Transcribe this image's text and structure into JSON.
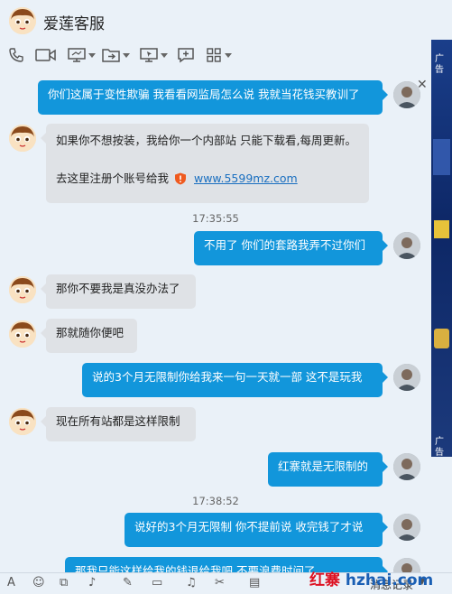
{
  "header": {
    "title": "爱莲客服"
  },
  "toolbar": {
    "icons": [
      "phone-icon",
      "video-icon",
      "screen-share-icon",
      "file-transfer-icon",
      "remote-desktop-icon",
      "add-icon",
      "apps-icon"
    ]
  },
  "messages": {
    "m1": "你们这属于变性欺骗 我看看网监局怎么说 我就当花钱买教训了",
    "m2_line1": "如果你不想按装，我给你一个内部站 只能下载看,每周更新。",
    "m2_line2_prefix": "去这里注册个账号给我",
    "m2_link": "www.5599mz.com",
    "ts1": "17:35:55",
    "m3": "不用了 你们的套路我弄不过你们",
    "m4": "那你不要我是真没办法了",
    "m5": "那就随你便吧",
    "m6": "说的3个月无限制你给我来一句一天就一部 这不是玩我",
    "m7": "现在所有站都是这样限制",
    "m8": "红寨就是无限制的",
    "ts2": "17:38:52",
    "m9": "说好的3个月无限制 你不提前说 收完钱了才说",
    "m10": "那我只能这样给我的钱退给我吧 不要浪费时间了"
  },
  "ad": {
    "label1": "广告",
    "label2": "广告"
  },
  "bottom_bar": {
    "history_label": "消息记录"
  },
  "watermark": {
    "brand": "红寨",
    "domain": "hzhai.com"
  }
}
